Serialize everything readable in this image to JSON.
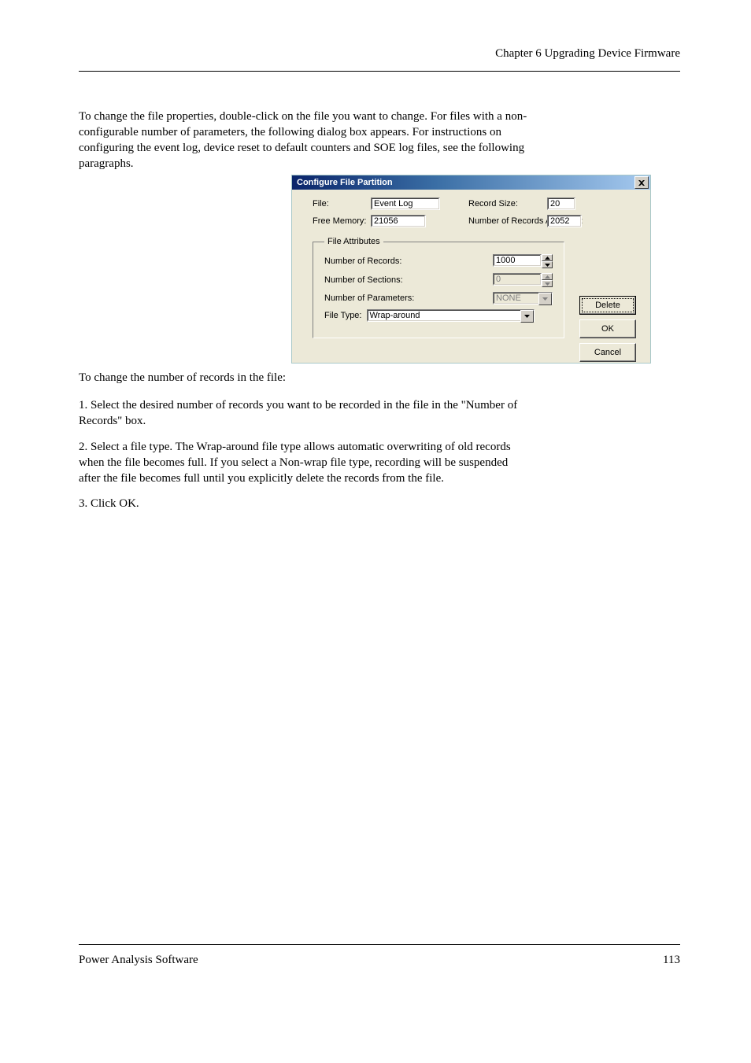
{
  "header": {
    "right": "Chapter 6  Upgrading Device Firmware"
  },
  "footer": {
    "left": "Power Analysis Software",
    "right": "113"
  },
  "text": {
    "p1a": "To change the file properties, double-click on the file you want to change. For files with a non-",
    "p1b": "configurable number of parameters, the following dialog box appears. For instructions on",
    "p1c": "configuring the event log, device reset to default counters and SOE log files, see the following",
    "p1d": "paragraphs.",
    "p2": "To change the number of records in the file:",
    "p3a": "1.   Select the desired number of records you want to be recorded in the file in the \"Number of",
    "p3b": "      Records\" box.",
    "p4a": "2.   Select a file type. The Wrap-around file type allows automatic overwriting of old records",
    "p4b": "      when the file becomes full. If you select a Non-wrap file type, recording will be suspended",
    "p4c": "      after the file becomes full until you explicitly delete the records from the file.",
    "p5": "3.   Click OK."
  },
  "dialog": {
    "title": "Configure File Partition",
    "labels": {
      "file": "File:",
      "freeMemory": "Free Memory:",
      "recordSize": "Record Size:",
      "recordsAvail": "Number of Records Available:",
      "fileAttributes": "File Attributes",
      "numRecords": "Number of Records:",
      "numSections": "Number of Sections:",
      "numParams": "Number of Parameters:",
      "fileType": "File Type:"
    },
    "values": {
      "file": "Event Log",
      "freeMemory": "21056",
      "recordSize": "20",
      "recordsAvail": "2052",
      "numRecords": "1000",
      "numSections": "0",
      "numParams": "NONE",
      "fileType": "Wrap-around"
    },
    "buttons": {
      "delete": "Delete",
      "ok": "OK",
      "cancel": "Cancel"
    }
  }
}
